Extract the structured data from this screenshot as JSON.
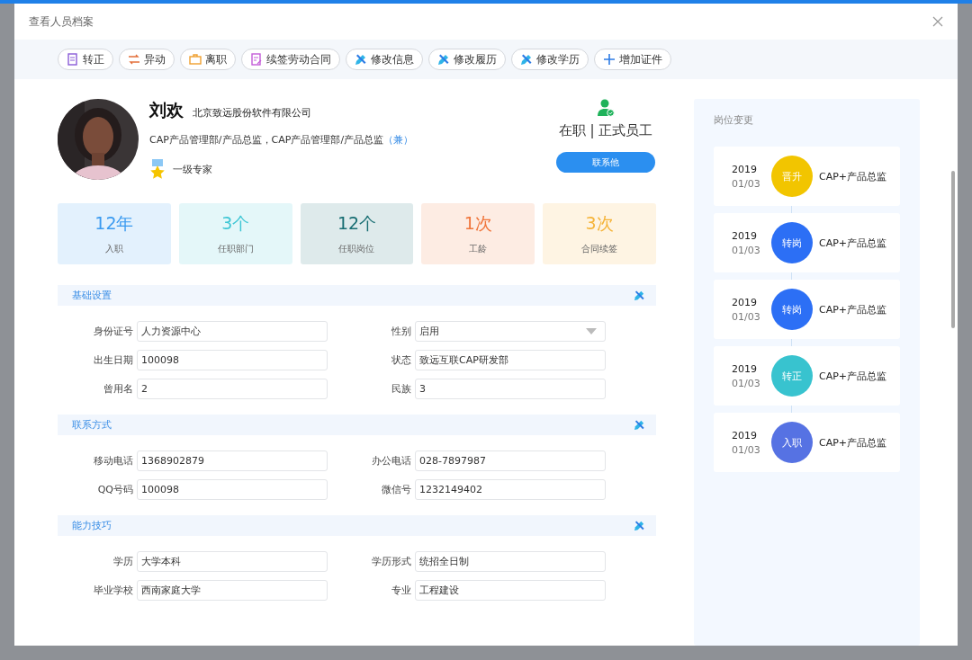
{
  "window": {
    "title": "查看人员档案"
  },
  "toolbar": [
    {
      "label": "转正",
      "kind": "document"
    },
    {
      "label": "异动",
      "kind": "swap"
    },
    {
      "label": "离职",
      "kind": "leave"
    },
    {
      "label": "续签劳动合同",
      "kind": "contract"
    },
    {
      "label": "修改信息",
      "kind": "edit"
    },
    {
      "label": "修改履历",
      "kind": "edit"
    },
    {
      "label": "修改学历",
      "kind": "edit"
    },
    {
      "label": "增加证件",
      "kind": "add"
    }
  ],
  "profile": {
    "name": "刘欢",
    "company": "北京致远股份软件有限公司",
    "positions": "CAP产品管理部/产品总监，CAP产品管理部/产品总监",
    "position_note": "（兼）",
    "honor": "一级专家",
    "status": "在职 | 正式员工",
    "contact_button": "联系他"
  },
  "stats": [
    {
      "value": "12年",
      "label": "入职",
      "color": "#3a9af0"
    },
    {
      "value": "3个",
      "label": "任职部门",
      "color": "#3ec6d4"
    },
    {
      "value": "12个",
      "label": "任职岗位",
      "color": "#176d72"
    },
    {
      "value": "1次",
      "label": "工龄",
      "color": "#f0763c"
    },
    {
      "value": "3次",
      "label": "合同续签",
      "color": "#f5b43a"
    }
  ],
  "sections": [
    {
      "title": "基础设置",
      "fields": [
        {
          "label": "身份证号",
          "value": "人力资源中心",
          "kind": "text"
        },
        {
          "label": "性别",
          "value": "启用",
          "kind": "select"
        },
        {
          "label": "出生日期",
          "value": "100098",
          "kind": "text"
        },
        {
          "label": "状态",
          "value": "致远互联CAP研发部",
          "kind": "text"
        },
        {
          "label": "曾用名",
          "value": "2",
          "kind": "text"
        },
        {
          "label": "民族",
          "value": "3",
          "kind": "text"
        }
      ]
    },
    {
      "title": "联系方式",
      "fields": [
        {
          "label": "移动电话",
          "value": "1368902879",
          "kind": "text"
        },
        {
          "label": "办公电话",
          "value": "028-7897987",
          "kind": "text"
        },
        {
          "label": "QQ号码",
          "value": "100098",
          "kind": "text"
        },
        {
          "label": "微信号",
          "value": "1232149402",
          "kind": "text"
        }
      ]
    },
    {
      "title": "能力技巧",
      "fields": [
        {
          "label": "学历",
          "value": "大学本科",
          "kind": "text"
        },
        {
          "label": "学历形式",
          "value": "统招全日制",
          "kind": "text"
        },
        {
          "label": "毕业学校",
          "value": "西南家庭大学",
          "kind": "text"
        },
        {
          "label": "专业",
          "value": "工程建设",
          "kind": "text"
        }
      ]
    }
  ],
  "timeline": {
    "title": "岗位变更",
    "items": [
      {
        "year": "2019",
        "date": "01/03",
        "event": "晋升",
        "color": "#f2c500",
        "position": "CAP+产品总监"
      },
      {
        "year": "2019",
        "date": "01/03",
        "event": "转岗",
        "color": "#2c6ff5",
        "position": "CAP+产品总监"
      },
      {
        "year": "2019",
        "date": "01/03",
        "event": "转岗",
        "color": "#2c6ff5",
        "position": "CAP+产品总监"
      },
      {
        "year": "2019",
        "date": "01/03",
        "event": "转正",
        "color": "#38c3cf",
        "position": "CAP+产品总监"
      },
      {
        "year": "2019",
        "date": "01/03",
        "event": "入职",
        "color": "#5672e3",
        "position": "CAP+产品总监"
      }
    ]
  }
}
